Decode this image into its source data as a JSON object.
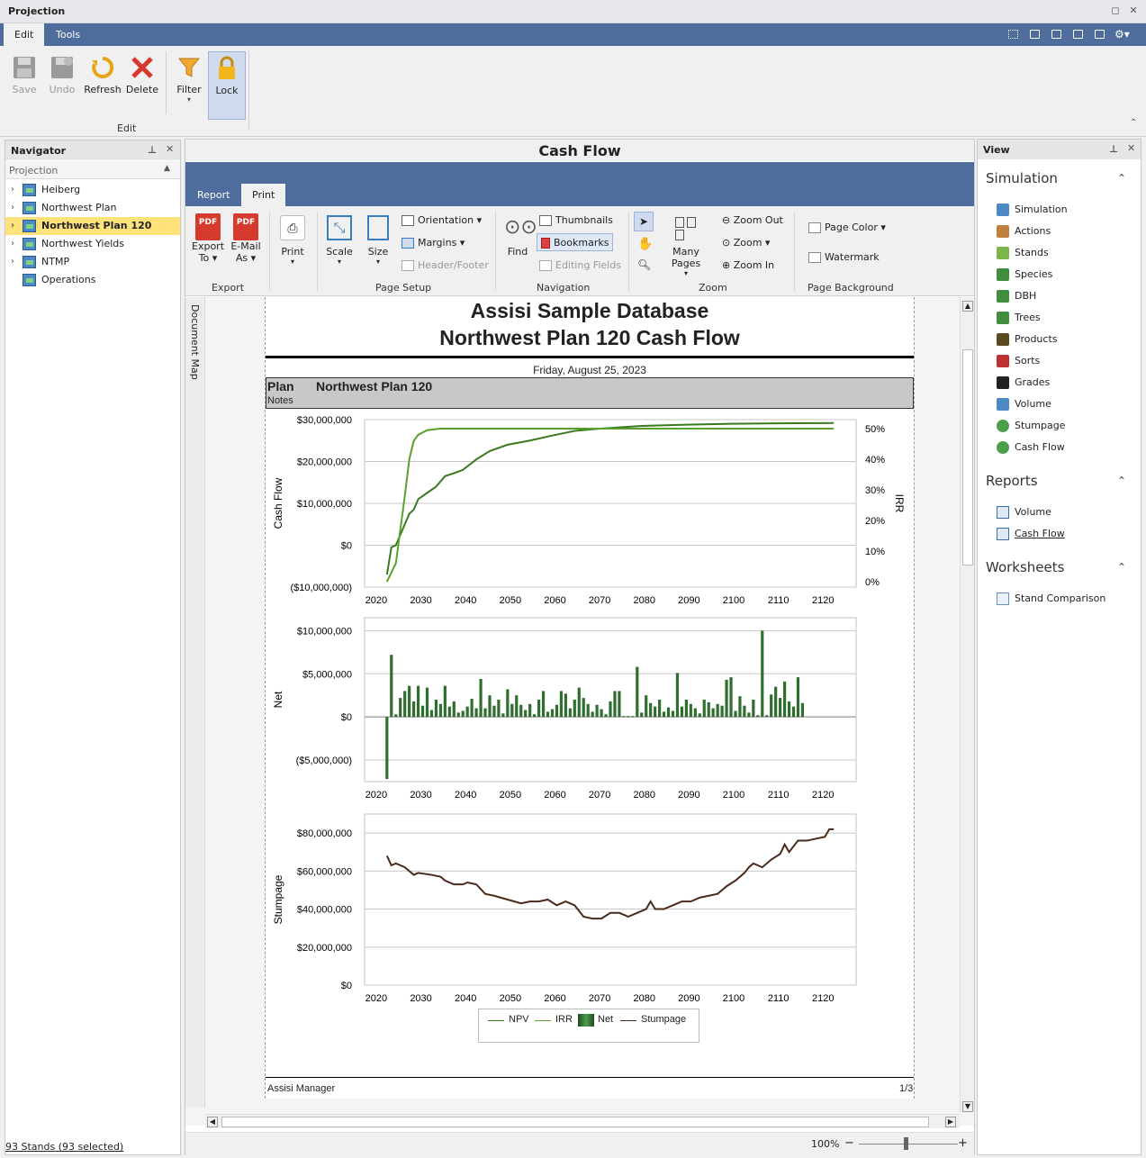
{
  "window": {
    "title": "Projection"
  },
  "menu": {
    "tabs": [
      "Edit",
      "Tools"
    ]
  },
  "ribbon": {
    "buttons": [
      {
        "label": "Save",
        "icon": "save-icon",
        "enabled": false
      },
      {
        "label": "Undo",
        "icon": "undo-icon",
        "enabled": false
      },
      {
        "label": "Refresh",
        "icon": "refresh-icon",
        "enabled": true
      },
      {
        "label": "Delete",
        "icon": "delete-icon",
        "enabled": true
      },
      {
        "label": "Filter",
        "icon": "filter-icon",
        "enabled": true
      },
      {
        "label": "Lock",
        "icon": "lock-icon",
        "enabled": true
      }
    ],
    "group_label": "Edit"
  },
  "navigator": {
    "title": "Navigator",
    "subheader": "Projection",
    "items": [
      {
        "label": "Heiberg",
        "expandable": true
      },
      {
        "label": "Northwest Plan",
        "expandable": true
      },
      {
        "label": "Northwest Plan 120",
        "expandable": true,
        "selected": true
      },
      {
        "label": "Northwest Yields",
        "expandable": true
      },
      {
        "label": "NTMP",
        "expandable": true
      },
      {
        "label": "Operations",
        "expandable": false
      }
    ],
    "status": "93 Stands (93 selected)"
  },
  "document": {
    "title": "Cash Flow",
    "tabs": [
      "Report",
      "Print"
    ],
    "print_ribbon": {
      "export_to": "Export",
      "export_to2": "To",
      "email": "E-Mail",
      "email2": "As",
      "print": "Print",
      "scale": "Scale",
      "size": "Size",
      "orientation": "Orientation",
      "margins": "Margins",
      "header_footer": "Header/Footer",
      "find": "Find",
      "thumbnails": "Thumbnails",
      "bookmarks": "Bookmarks",
      "editing_fields": "Editing Fields",
      "many_pages": "Many Pages",
      "zoom_out": "Zoom Out",
      "zoom": "Zoom",
      "zoom_in": "Zoom In",
      "page_color": "Page Color",
      "watermark": "Watermark",
      "groups": [
        "Export",
        "Page Setup",
        "Navigation",
        "Zoom",
        "Page Background"
      ]
    },
    "document_map": "Document Map",
    "report": {
      "title1": "Assisi Sample Database",
      "title2": "Northwest Plan 120 Cash Flow",
      "date": "Friday, August 25, 2023",
      "plan_label": "Plan",
      "plan_value": "Northwest Plan 120",
      "notes_label": "Notes",
      "footer_left": "Assisi Manager",
      "footer_right": "1/3"
    },
    "zoom_level": "100%"
  },
  "view_panel": {
    "title": "View",
    "sections": [
      {
        "title": "Simulation",
        "items": [
          "Simulation",
          "Actions",
          "Stands",
          "Species",
          "DBH",
          "Trees",
          "Products",
          "Sorts",
          "Grades",
          "Volume",
          "Stumpage",
          "Cash Flow"
        ]
      },
      {
        "title": "Reports",
        "items": [
          "Volume",
          "Cash Flow"
        ]
      },
      {
        "title": "Worksheets",
        "items": [
          "Stand Comparison"
        ]
      }
    ]
  },
  "chart_data": [
    {
      "type": "line",
      "ylabel": "Cash Flow",
      "y2label": "IRR",
      "ylim": [
        -10000000,
        30000000
      ],
      "y2lim": [
        0,
        50
      ],
      "yticks": [
        "$30,000,000",
        "$20,000,000",
        "$10,000,000",
        "$0",
        "($10,000,000)"
      ],
      "y2ticks": [
        "50%",
        "40%",
        "30%",
        "20%",
        "10%",
        "0%"
      ],
      "xticks": [
        "2020",
        "2030",
        "2040",
        "2050",
        "2060",
        "2070",
        "2080",
        "2090",
        "2100",
        "2110",
        "2120"
      ],
      "series": [
        {
          "name": "NPV",
          "color": "#3a7a1e",
          "x": [
            2023,
            2024,
            2025,
            2026,
            2027,
            2028,
            2029,
            2030,
            2032,
            2034,
            2036,
            2038,
            2040,
            2043,
            2046,
            2050,
            2055,
            2060,
            2065,
            2070,
            2080,
            2090,
            2100,
            2110,
            2123
          ],
          "values": [
            -7000000,
            -500000,
            0,
            2500000,
            5000000,
            7500000,
            8500000,
            11000000,
            12500000,
            14000000,
            16500000,
            17200000,
            18000000,
            20500000,
            22500000,
            24000000,
            25000000,
            26200000,
            27300000,
            27800000,
            28500000,
            28800000,
            29000000,
            29100000,
            29200000
          ]
        },
        {
          "name": "IRR",
          "color": "#5aa02c",
          "x": [
            2023,
            2025,
            2027,
            2028,
            2029,
            2030,
            2032,
            2035,
            2040,
            2060,
            2080,
            2100,
            2123
          ],
          "values": [
            0,
            6,
            28,
            40,
            46,
            48,
            49.5,
            50,
            50,
            50,
            50,
            50,
            50
          ],
          "axis": "y2"
        }
      ]
    },
    {
      "type": "bar",
      "ylabel": "Net",
      "ylim": [
        -7500000,
        11500000
      ],
      "yticks": [
        "$10,000,000",
        "$5,000,000",
        "$0",
        "($5,000,000)"
      ],
      "xticks": [
        "2020",
        "2030",
        "2040",
        "2050",
        "2060",
        "2070",
        "2080",
        "2090",
        "2100",
        "2110",
        "2120"
      ],
      "series": [
        {
          "name": "Net",
          "color": "#2f6e2f",
          "x_start": 2023,
          "values": [
            -7200000,
            7200000,
            300000,
            2200000,
            3000000,
            3600000,
            1800000,
            3600000,
            1300000,
            3400000,
            800000,
            2000000,
            1500000,
            3600000,
            1200000,
            1800000,
            500000,
            700000,
            1200000,
            2100000,
            1000000,
            4400000,
            1000000,
            2500000,
            1300000,
            2000000,
            400000,
            3200000,
            1500000,
            2500000,
            1400000,
            800000,
            1500000,
            300000,
            2000000,
            3000000,
            600000,
            900000,
            1400000,
            3000000,
            2700000,
            1000000,
            2000000,
            3400000,
            2200000,
            1500000,
            600000,
            1400000,
            900000,
            300000,
            1800000,
            3000000,
            3000000,
            100000,
            100000,
            100000,
            5800000,
            500000,
            2500000,
            1600000,
            1200000,
            2000000,
            600000,
            1100000,
            700000,
            5100000,
            1200000,
            2000000,
            1500000,
            1000000,
            400000,
            2000000,
            1700000,
            1000000,
            1500000,
            1300000,
            4300000,
            4600000,
            700000,
            2400000,
            1300000,
            500000,
            2000000,
            200000,
            10000000,
            200000,
            2600000,
            3500000,
            2200000,
            4100000,
            1800000,
            1200000,
            4600000,
            1600000
          ]
        }
      ]
    },
    {
      "type": "line",
      "ylabel": "Stumpage",
      "ylim": [
        0,
        90000000
      ],
      "yticks": [
        "$80,000,000",
        "$60,000,000",
        "$40,000,000",
        "$20,000,000",
        "$0"
      ],
      "xticks": [
        "2020",
        "2030",
        "2040",
        "2050",
        "2060",
        "2070",
        "2080",
        "2090",
        "2100",
        "2110",
        "2120"
      ],
      "series": [
        {
          "name": "Stumpage",
          "color": "#4a2a1a",
          "x": [
            2023,
            2024,
            2025,
            2027,
            2028,
            2029,
            2030,
            2033,
            2035,
            2036,
            2038,
            2040,
            2041,
            2043,
            2045,
            2047,
            2050,
            2053,
            2055,
            2057,
            2059,
            2061,
            2063,
            2065,
            2066,
            2067,
            2069,
            2071,
            2073,
            2075,
            2077,
            2079,
            2081,
            2082,
            2083,
            2085,
            2087,
            2089,
            2091,
            2093,
            2095,
            2097,
            2099,
            2101,
            2103,
            2104,
            2105,
            2107,
            2109,
            2111,
            2112,
            2113,
            2115,
            2117,
            2119,
            2121,
            2122,
            2123
          ],
          "values": [
            68000000,
            63000000,
            64000000,
            62000000,
            60000000,
            58000000,
            59000000,
            58000000,
            57000000,
            55000000,
            53000000,
            53000000,
            54000000,
            53000000,
            48000000,
            47000000,
            45000000,
            43000000,
            44000000,
            44000000,
            45000000,
            42000000,
            44000000,
            42000000,
            39000000,
            36000000,
            35000000,
            35000000,
            38000000,
            38000000,
            36000000,
            38000000,
            40000000,
            44000000,
            40000000,
            40000000,
            42000000,
            44000000,
            44000000,
            46000000,
            47000000,
            48000000,
            52000000,
            55000000,
            59000000,
            62000000,
            64000000,
            62000000,
            66000000,
            69000000,
            74000000,
            70000000,
            76000000,
            76000000,
            77000000,
            78000000,
            82000000,
            82000000
          ]
        }
      ]
    }
  ],
  "legend": [
    "NPV",
    "IRR",
    "Net",
    "Stumpage"
  ],
  "colors": {
    "accent": "#4e6c9c",
    "nav_selected": "#ffe27a"
  }
}
